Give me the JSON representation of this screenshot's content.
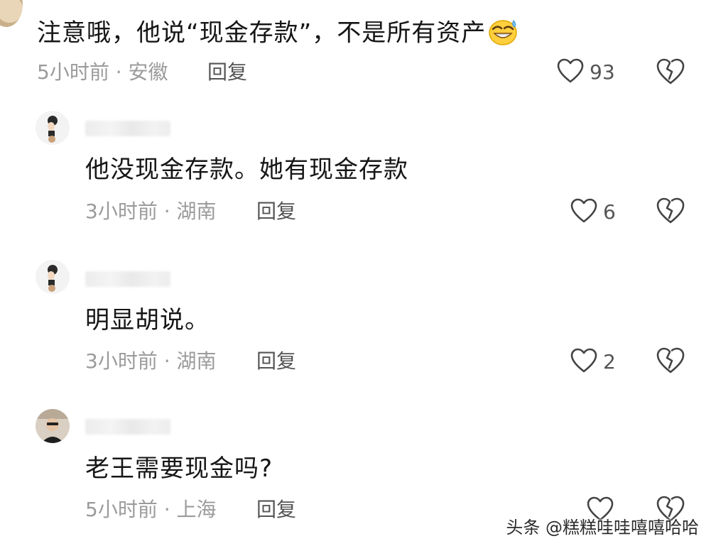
{
  "watermark": "头条 @糕糕哇哇嘻嘻哈哈",
  "reply_label": "回复",
  "comments": [
    {
      "text": "注意哦，他说“现金存款”，不是所有资产",
      "emoji": "grinning-sweat-emoji",
      "meta": "5小时前 · 安徽",
      "likes": "93"
    },
    {
      "text": "他没现金存款。她有现金存款",
      "meta": "3小时前 · 湖南",
      "likes": "6"
    },
    {
      "text": "明显胡说。",
      "meta": "3小时前 · 湖南",
      "likes": "2"
    },
    {
      "text": "老王需要现金吗?",
      "meta": "5小时前 · 上海",
      "likes": ""
    }
  ],
  "icons": {
    "like": "heart-outline-icon",
    "dislike": "broken-heart-icon"
  },
  "colors": {
    "text": "#161616",
    "meta": "#9b9b9b",
    "icon": "#444444",
    "background": "#ffffff"
  }
}
